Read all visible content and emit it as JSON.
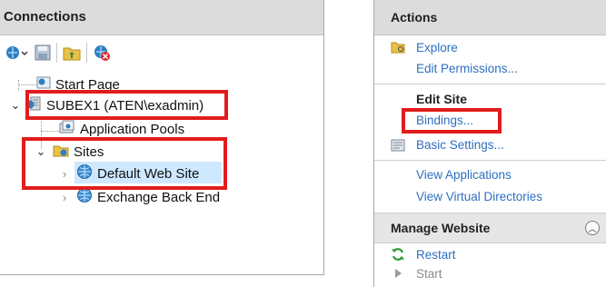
{
  "connections": {
    "title": "Connections",
    "tree": {
      "start_page": "Start Page",
      "server": "SUBEX1 (ATEN\\exadmin)",
      "app_pools": "Application Pools",
      "sites": "Sites",
      "default_site": "Default Web Site",
      "exchange_back_end": "Exchange Back End"
    }
  },
  "actions": {
    "title": "Actions",
    "explore": "Explore",
    "edit_permissions": "Edit Permissions...",
    "edit_site": "Edit Site",
    "bindings": "Bindings...",
    "basic_settings": "Basic Settings...",
    "view_applications": "View Applications",
    "view_virtual_directories": "View Virtual Directories",
    "manage_website": "Manage Website",
    "restart": "Restart",
    "start": "Start"
  },
  "colors": {
    "highlight": "#e21c1c",
    "link": "#2d6fc0",
    "header_bg": "#dcdcdc"
  }
}
